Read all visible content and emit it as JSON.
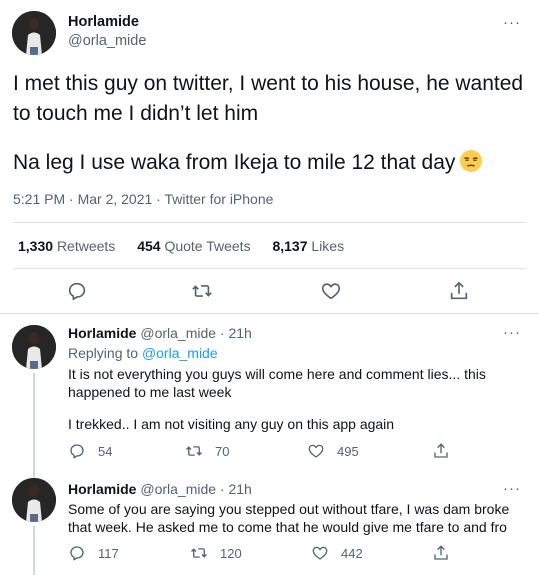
{
  "main": {
    "name": "Horlamide",
    "handle": "@orla_mide",
    "text_line1": "I met this guy on twitter, I went to his house, he wanted to touch me I didn’t let him",
    "text_line2": "Na leg I use waka from Ikeja to mile 12 that day",
    "emoji": "unamused-face-emoji",
    "meta": "5:21 PM · Mar 2, 2021 · Twitter for iPhone",
    "stats": {
      "retweets_count": "1,330",
      "retweets_label": "Retweets",
      "quotes_count": "454",
      "quotes_label": "Quote Tweets",
      "likes_count": "8,137",
      "likes_label": "Likes"
    },
    "more_label": "···"
  },
  "replies": [
    {
      "name": "Horlamide",
      "handle_time": "@orla_mide · 21h",
      "replying_prefix": "Replying to",
      "replying_to": "@orla_mide",
      "text1": "It is not everything you guys will come here and comment lies... this happened to me last week",
      "text2": "I trekked.. I am not visiting any guy on this app again",
      "reply_count": "54",
      "retweet_count": "70",
      "like_count": "495",
      "more_label": "···"
    },
    {
      "name": "Horlamide",
      "handle_time": "@orla_mide · 21h",
      "text1": "Some of you are saying you stepped out without tfare, I was dam broke that week. He asked me to come that he would give me tfare to and fro",
      "reply_count": "117",
      "retweet_count": "120",
      "like_count": "442",
      "more_label": "···"
    }
  ],
  "colors": {
    "text": "#0f1419",
    "secondary": "#536471",
    "link": "#1d9bf0",
    "divider": "#dfe4e8"
  },
  "icons": [
    "reply-icon",
    "retweet-icon",
    "like-icon",
    "share-icon",
    "more-icon"
  ]
}
